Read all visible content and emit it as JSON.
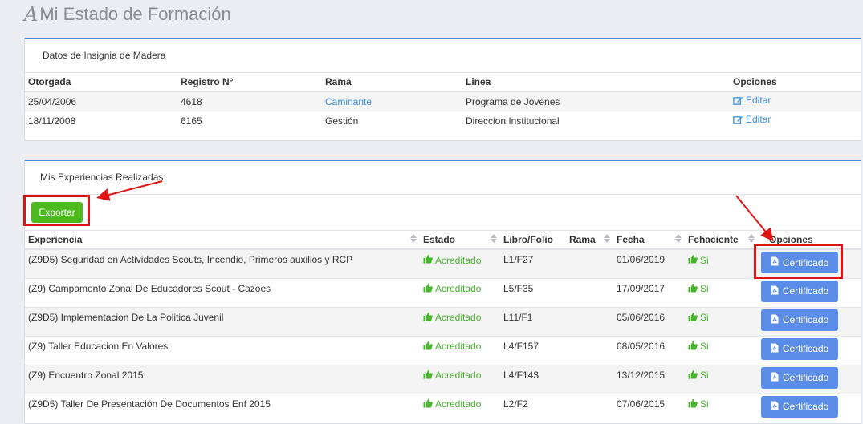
{
  "page": {
    "title": "Mi Estado de Formación"
  },
  "insignia": {
    "heading": "Datos de Insignia de Madera",
    "columns": [
      "Otorgada",
      "Registro N°",
      "Rama",
      "Linea",
      "Opciones"
    ],
    "rows": [
      {
        "otorgada": "25/04/2006",
        "registro": "4618",
        "rama": "Caminante",
        "linea": "Programa de Jovenes",
        "opcion": "Editar"
      },
      {
        "otorgada": "18/11/2008",
        "registro": "6165",
        "rama": "Gestión",
        "linea": "Direccion Institucional",
        "opcion": "Editar"
      }
    ]
  },
  "experiencias": {
    "heading": "Mis Experiencias Realizadas",
    "export_label": "Exportar",
    "columns": [
      "Experiencia",
      "Estado",
      "Libro/Folio",
      "Rama",
      "Fecha",
      "Fehaciente",
      "Opciones"
    ],
    "rows": [
      {
        "experiencia": "(Z9D5) Seguridad en Actividades Scouts, Incendio, Primeros auxilios y RCP",
        "estado": "Acreditado",
        "libro": "L1/F27",
        "rama": "",
        "fecha": "01/06/2019",
        "fehaciente": "Si",
        "opcion": "Certificado"
      },
      {
        "experiencia": "(Z9) Campamento Zonal De Educadores Scout - Cazoes",
        "estado": "Acreditado",
        "libro": "L5/F35",
        "rama": "",
        "fecha": "17/09/2017",
        "fehaciente": "Si",
        "opcion": "Certificado"
      },
      {
        "experiencia": "(Z9D5) Implementacion De La Politica Juvenil",
        "estado": "Acreditado",
        "libro": "L11/F1",
        "rama": "",
        "fecha": "05/06/2016",
        "fehaciente": "Si",
        "opcion": "Certificado"
      },
      {
        "experiencia": "(Z9) Taller Educacion En Valores",
        "estado": "Acreditado",
        "libro": "L4/F157",
        "rama": "",
        "fecha": "08/05/2016",
        "fehaciente": "Si",
        "opcion": "Certificado"
      },
      {
        "experiencia": "(Z9) Encuentro Zonal 2015",
        "estado": "Acreditado",
        "libro": "L4/F143",
        "rama": "",
        "fecha": "13/12/2015",
        "fehaciente": "Si",
        "opcion": "Certificado"
      },
      {
        "experiencia": "(Z9D5) Taller De Presentación De Documentos Enf 2015",
        "estado": "Acreditado",
        "libro": "L2/F2",
        "rama": "",
        "fecha": "07/06/2015",
        "fehaciente": "Si",
        "opcion": "Certificado"
      }
    ]
  },
  "colors": {
    "accent": "#3c8dde",
    "export_button": "#4cb91f",
    "cert_button": "#5b8de8",
    "status_green": "#45b52a",
    "highlight": "#e01313"
  },
  "icons": {
    "logo": "scout-logo-icon",
    "edit": "edit-icon",
    "status": "thumbs-up-icon",
    "certificate": "pdf-file-icon",
    "sort": "sort-icon"
  }
}
